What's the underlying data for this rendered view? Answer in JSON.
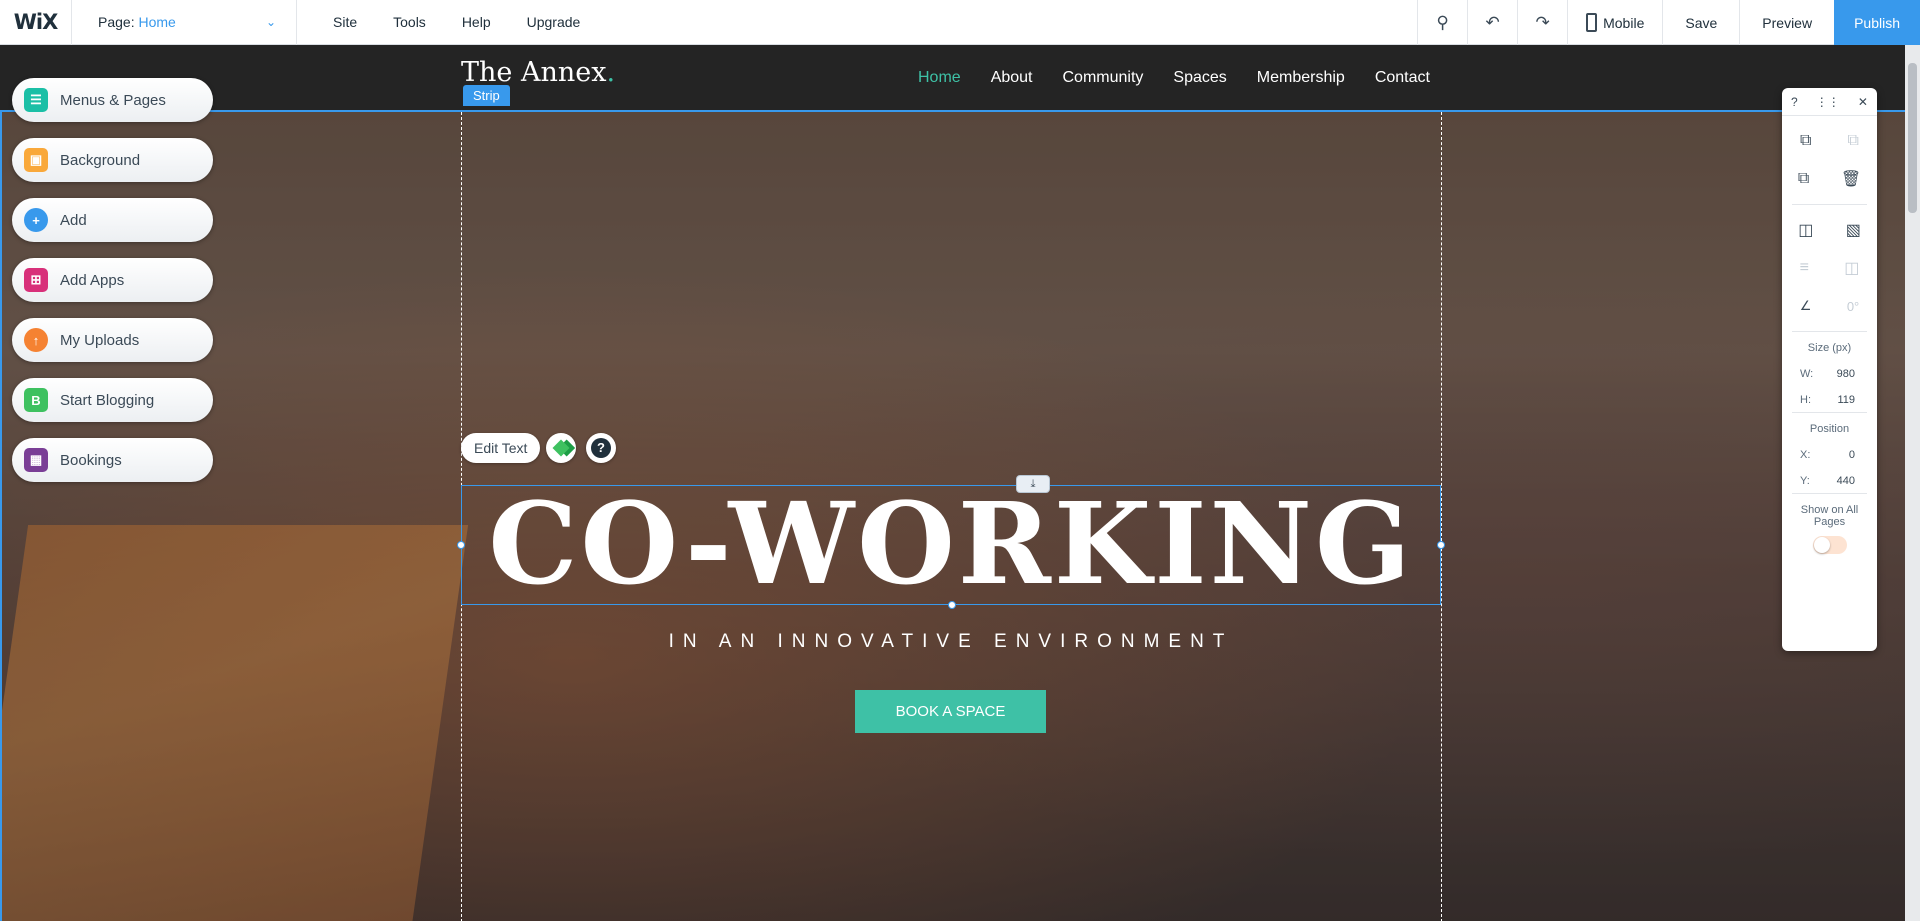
{
  "topbar": {
    "logo": "WiX",
    "page_label": "Page:",
    "page_value": "Home",
    "menu": [
      "Site",
      "Tools",
      "Help",
      "Upgrade"
    ],
    "mobile_label": "Mobile",
    "save_label": "Save",
    "preview_label": "Preview",
    "publish_label": "Publish"
  },
  "site": {
    "brand": "The Annex",
    "brand_dot": ".",
    "nav": [
      "Home",
      "About",
      "Community",
      "Spaces",
      "Membership",
      "Contact"
    ],
    "hero_title": "CO-WORKING",
    "hero_subtitle": "IN AN INNOVATIVE ENVIRONMENT",
    "cta_label": "BOOK A SPACE",
    "accent_color": "#3ec1a6"
  },
  "editor": {
    "strip_label": "Strip",
    "edit_text_label": "Edit Text"
  },
  "left_panel": {
    "items": [
      {
        "label": "Menus & Pages",
        "icon": "pages-icon",
        "color": "#1bbfa6"
      },
      {
        "label": "Background",
        "icon": "background-icon",
        "color": "#f9a83a"
      },
      {
        "label": "Add",
        "icon": "plus-icon",
        "color": "#3899ec"
      },
      {
        "label": "Add Apps",
        "icon": "apps-icon",
        "color": "#d8307a"
      },
      {
        "label": "My Uploads",
        "icon": "upload-cloud-icon",
        "color": "#f58232"
      },
      {
        "label": "Start Blogging",
        "icon": "blog-icon",
        "color": "#3ec160"
      },
      {
        "label": "Bookings",
        "icon": "calendar-icon",
        "color": "#7a3e96"
      }
    ]
  },
  "right_panel": {
    "rotation": "0°",
    "size_label": "Size (px)",
    "w_label": "W:",
    "w_value": "980",
    "h_label": "H:",
    "h_value": "119",
    "position_label": "Position",
    "x_label": "X:",
    "x_value": "0",
    "y_label": "Y:",
    "y_value": "440",
    "show_all_label": "Show on All Pages"
  }
}
